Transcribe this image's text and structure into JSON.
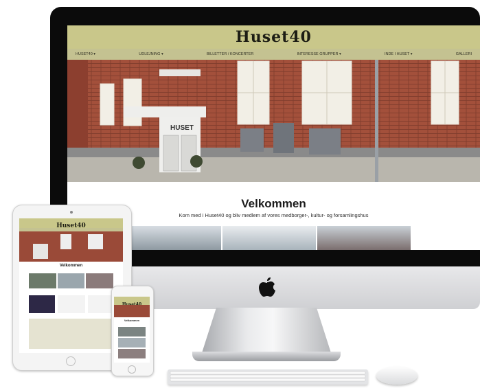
{
  "site": {
    "logo": "Huset40",
    "nav": [
      "HUSET40 ▾",
      "UDLEJNING ▾",
      "BILLETTER / KONCERTER",
      "INTERESSE GRUPPER ▾",
      "INDE I HUSET ▾",
      "GALLERI"
    ],
    "hero_sign": "HUSET",
    "welcome_title": "Velkommen",
    "welcome_sub": "Kom med i Huset40 og bliv medlem af vores medborger-, kultur- og forsamlingshus"
  },
  "tablet": {
    "logo": "Huset40",
    "welcome_title": "Velkommen"
  },
  "phone": {
    "logo": "Huset40",
    "welcome_title": "Velkommen"
  },
  "colors": {
    "header": "#c9c78a",
    "brick": "#9a4a38",
    "frame": "#0b0b0b"
  }
}
